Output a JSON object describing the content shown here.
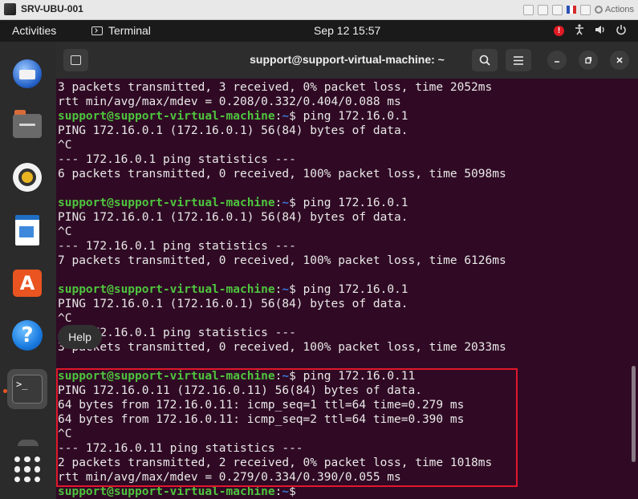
{
  "vm_window": {
    "title": "SRV-UBU-001",
    "actions_label": "Actions"
  },
  "top_panel": {
    "activities_label": "Activities",
    "app_name": "Terminal",
    "clock": "Sep 12  15:57",
    "alert_glyph": "!"
  },
  "dock": {
    "items": [
      {
        "name": "thunderbird-icon"
      },
      {
        "name": "files-icon"
      },
      {
        "name": "rhythmbox-icon"
      },
      {
        "name": "libreoffice-writer-icon"
      },
      {
        "name": "app-center-icon",
        "glyph": "A"
      },
      {
        "name": "help-icon",
        "glyph": "?"
      },
      {
        "name": "terminal-icon",
        "glyph": ">_"
      },
      {
        "name": "show-apps-icon"
      }
    ],
    "tooltip": "Help"
  },
  "terminal": {
    "title": "support@support-virtual-machine: ~",
    "prompt": {
      "user": "support@support-virtual-machine",
      "sep": ":",
      "path": "~",
      "symbol": "$ "
    },
    "lines": [
      {
        "type": "out",
        "text": "3 packets transmitted, 3 received, 0% packet loss, time 2052ms"
      },
      {
        "type": "out",
        "text": "rtt min/avg/max/mdev = 0.208/0.332/0.404/0.088 ms"
      },
      {
        "type": "prompt",
        "cmd": "ping 172.16.0.1"
      },
      {
        "type": "out",
        "text": "PING 172.16.0.1 (172.16.0.1) 56(84) bytes of data."
      },
      {
        "type": "out",
        "text": "^C"
      },
      {
        "type": "out",
        "text": "--- 172.16.0.1 ping statistics ---"
      },
      {
        "type": "out",
        "text": "6 packets transmitted, 0 received, 100% packet loss, time 5098ms"
      },
      {
        "type": "out",
        "text": ""
      },
      {
        "type": "prompt",
        "cmd": "ping 172.16.0.1"
      },
      {
        "type": "out",
        "text": "PING 172.16.0.1 (172.16.0.1) 56(84) bytes of data."
      },
      {
        "type": "out",
        "text": "^C"
      },
      {
        "type": "out",
        "text": "--- 172.16.0.1 ping statistics ---"
      },
      {
        "type": "out",
        "text": "7 packets transmitted, 0 received, 100% packet loss, time 6126ms"
      },
      {
        "type": "out",
        "text": ""
      },
      {
        "type": "prompt",
        "cmd": "ping 172.16.0.1"
      },
      {
        "type": "out",
        "text": "PING 172.16.0.1 (172.16.0.1) 56(84) bytes of data."
      },
      {
        "type": "out",
        "text": "^C"
      },
      {
        "type": "out",
        "text": "--- 172.16.0.1 ping statistics ---"
      },
      {
        "type": "out",
        "text": "3 packets transmitted, 0 received, 100% packet loss, time 2033ms"
      },
      {
        "type": "out",
        "text": ""
      },
      {
        "type": "prompt",
        "cmd": "ping 172.16.0.11"
      },
      {
        "type": "out",
        "text": "PING 172.16.0.11 (172.16.0.11) 56(84) bytes of data."
      },
      {
        "type": "out",
        "text": "64 bytes from 172.16.0.11: icmp_seq=1 ttl=64 time=0.279 ms"
      },
      {
        "type": "out",
        "text": "64 bytes from 172.16.0.11: icmp_seq=2 ttl=64 time=0.390 ms"
      },
      {
        "type": "out",
        "text": "^C"
      },
      {
        "type": "out",
        "text": "--- 172.16.0.11 ping statistics ---"
      },
      {
        "type": "out",
        "text": "2 packets transmitted, 2 received, 0% packet loss, time 1018ms"
      },
      {
        "type": "out",
        "text": "rtt min/avg/max/mdev = 0.279/0.334/0.390/0.055 ms"
      },
      {
        "type": "prompt",
        "cmd": ""
      }
    ]
  },
  "colors": {
    "terminal_bg": "#300a24",
    "prompt_user": "#4ec43e",
    "prompt_path": "#3a76d8",
    "highlight_box": "#e0182b",
    "ubuntu_orange": "#e95420"
  }
}
